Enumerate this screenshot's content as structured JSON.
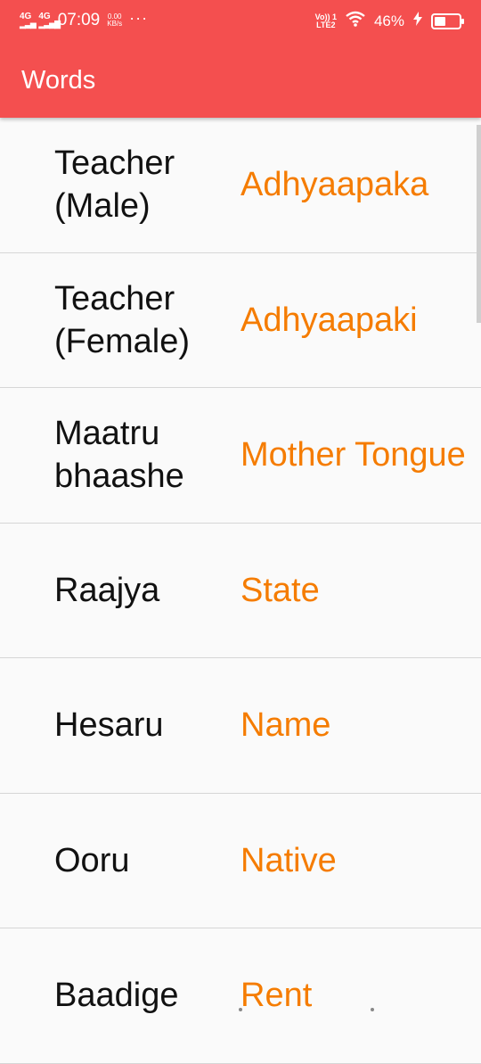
{
  "status_bar": {
    "net1": "4G",
    "net2": "4G",
    "time": "07:09",
    "speed_value": "0.00",
    "speed_unit": "KB/s",
    "more": "···",
    "volte_top": "Vo)) 1",
    "volte_bottom": "LTE2",
    "battery": "46%"
  },
  "app_bar": {
    "title": "Words",
    "color": "#f44f4f"
  },
  "list": {
    "items": [
      {
        "word": "Teacher (Male)",
        "meaning": "Adhyaapaka"
      },
      {
        "word": "Teacher (Female)",
        "meaning": "Adhyaapaki"
      },
      {
        "word": "Maatru bhaashe",
        "meaning": "Mother Tongue"
      },
      {
        "word": "Raajya",
        "meaning": "State"
      },
      {
        "word": "Hesaru",
        "meaning": "Name"
      },
      {
        "word": "Ooru",
        "meaning": "Native"
      },
      {
        "word": "Baadige",
        "meaning": "Rent"
      }
    ],
    "meaning_color": "#f57c00"
  }
}
